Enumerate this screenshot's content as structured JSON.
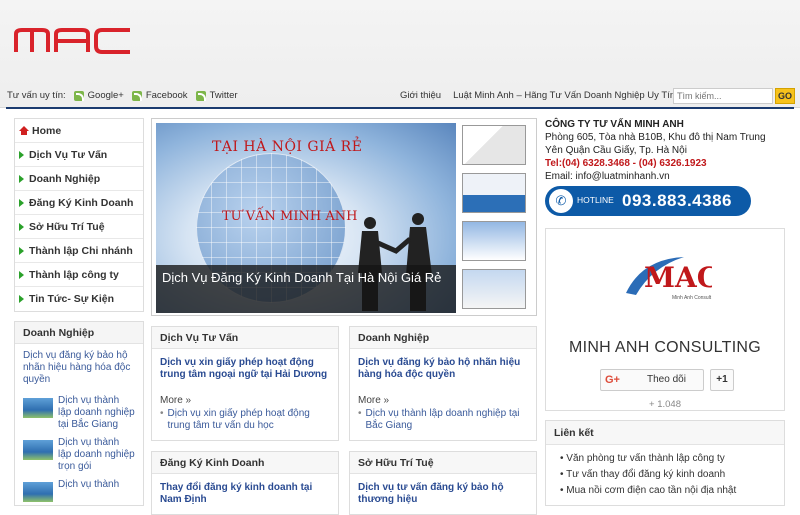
{
  "header": {
    "social_label": "Tư vấn uy tín:",
    "social": [
      "Google+",
      "Facebook",
      "Twitter"
    ],
    "nav": [
      "Giới thiệu",
      "Luật Minh Anh – Hãng Tư Vấn Doanh Nghiệp Uy Tín"
    ],
    "search_placeholder": "Tìm kiếm...",
    "search_button": "GO"
  },
  "sidebar": {
    "menu": [
      "Home",
      "Dịch Vụ Tư Vấn",
      "Doanh Nghiệp",
      "Đăng Ký Kinh Doanh",
      "Sở Hữu Trí Tuệ",
      "Thành lập Chi nhánh",
      "Thành lập công ty",
      "Tin Tức- Sự Kiện"
    ],
    "box_title": "Doanh Nghiệp",
    "intro": "Dịch vụ đăng ký bảo hộ nhãn hiệu hàng hóa độc quyền",
    "items": [
      "Dịch vụ thành lập doanh nghiệp tại Bắc Giang",
      "Dịch vụ thành lập doanh nghiệp trọn gói",
      "Dịch vụ thành"
    ]
  },
  "slider": {
    "hero_title": "TẠI HÀ NỘI GIÁ RẺ",
    "hero_sub": "TƯ VẤN MINH ANH",
    "caption": "Dịch Vụ Đăng Ký Kinh Doanh Tại Hà Nội Giá Rẻ"
  },
  "cards": [
    {
      "title": "Dịch Vụ Tư Vấn",
      "main": "Dịch vụ xin giấy phép hoạt động trung tâm ngoại ngữ tại Hải Dương",
      "more": "More »",
      "sub": "Dịch vụ xin giấy phép hoạt động trung tâm tư vấn du học"
    },
    {
      "title": "Doanh Nghiệp",
      "main": "Dịch vụ đăng ký bảo hộ nhãn hiệu hàng hóa độc quyền",
      "more": "More »",
      "sub": "Dịch vụ thành lập doanh nghiệp tại Bắc Giang"
    },
    {
      "title": "Đăng Ký Kinh Doanh",
      "main": "Thay đổi đăng ký kinh doanh tại Nam Định",
      "more": "",
      "sub": ""
    },
    {
      "title": "Sở Hữu Trí Tuệ",
      "main": "Dịch vụ tư vấn đăng ký bảo hộ thương hiệu",
      "more": "",
      "sub": ""
    }
  ],
  "company": {
    "name": "CÔNG TY TƯ VẤN MINH ANH",
    "address": "Phòng 605, Tòa nhà B10B, Khu đô thị Nam Trung Yên Quận Cầu Giấy, Tp. Hà Nội",
    "tel_label": "Tel:",
    "tel": "(04) 6328.3468 - (04) 6326.1923",
    "email": "Email:  info@luatminhanh.vn",
    "hotline_label": "HOTLINE",
    "hotline": "093.883.4386"
  },
  "gplus": {
    "name": "MINH ANH CONSULTING",
    "follow": "Theo dõi",
    "plusone": "+1",
    "count": "+ 1.048",
    "logo_text": "MAC",
    "logo_sub": "Minh Anh Consult"
  },
  "links": {
    "title": "Liên kết",
    "items": [
      "Văn phòng tư vấn thành lập công ty",
      "Tư vấn thay đổi đăng ký kinh doanh",
      "Mua nồi cơm điện cao tần nội địa nhật"
    ]
  },
  "colors": {
    "brand_red": "#c0181b",
    "nav_blue": "#1b3b6f",
    "hotline_blue": "#0d5aa7",
    "rss_green": "#7db64a"
  }
}
